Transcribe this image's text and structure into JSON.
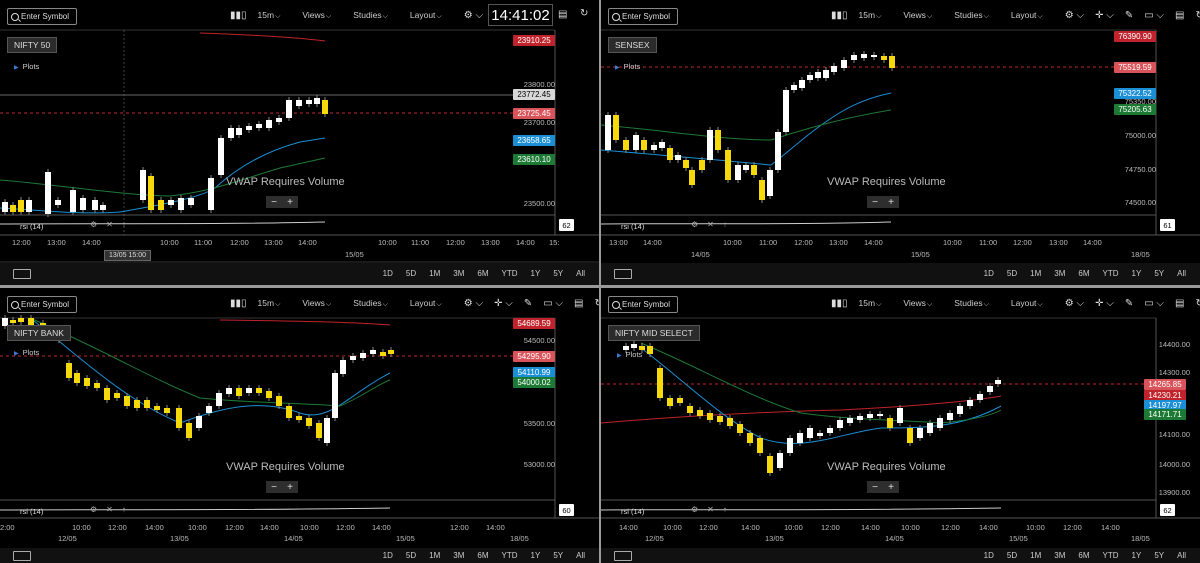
{
  "clock": "14:41:02",
  "toolbar": {
    "search_placeholder": "Enter Symbol",
    "interval": "15m",
    "views": "Views",
    "studies": "Studies",
    "layout": "Layout"
  },
  "panels": [
    {
      "symbol": "NIFTY 50",
      "plots": "Plots",
      "vwap_note": "VWAP Requires Volume",
      "zoom_minus": "−",
      "zoom_plus": "+",
      "rsi_label": "rsi (14)",
      "rsi_value": "62",
      "price_boxes": [
        {
          "text": "23910.25",
          "color": "#c0232b"
        },
        {
          "text": "23772.45",
          "color": "#d8d8d8"
        },
        {
          "text": "23725.45",
          "color": "#d9535a"
        },
        {
          "text": "23658.65",
          "color": "#1a8fd6"
        },
        {
          "text": "23610.10",
          "color": "#1d7a35"
        }
      ],
      "axis_labels": [
        "23800.00",
        "23700.00",
        "23500.00"
      ],
      "time_labels": [
        "12:00",
        "13:00",
        "14:00",
        "10:00",
        "11:00",
        "12:00",
        "13:00",
        "14:00",
        "10:00",
        "11:00",
        "12:00",
        "13:00",
        "14:00",
        "15:"
      ],
      "date_labels": [
        "15/05"
      ],
      "tooltip": "13/05 15:00"
    },
    {
      "symbol": "SENSEX",
      "plots": "Plots",
      "vwap_note": "VWAP Requires Volume",
      "zoom_minus": "−",
      "zoom_plus": "+",
      "rsi_label": "rsi (14)",
      "rsi_value": "61",
      "price_boxes": [
        {
          "text": "76390.90",
          "color": "#c0232b"
        },
        {
          "text": "75519.59",
          "color": "#d9535a"
        },
        {
          "text": "75322.52",
          "color": "#1a8fd6"
        },
        {
          "text": "75205.63",
          "color": "#1d7a35"
        }
      ],
      "axis_labels": [
        "75350.00",
        "75000.00",
        "74750.00",
        "74500.00"
      ],
      "time_labels": [
        "13:00",
        "14:00",
        "10:00",
        "11:00",
        "12:00",
        "13:00",
        "14:00",
        "10:00",
        "11:00",
        "12:00",
        "13:00",
        "14:00"
      ],
      "date_labels": [
        "14/05",
        "15/05",
        "18/05"
      ]
    },
    {
      "symbol": "NIFTY BANK",
      "plots": "Plots",
      "vwap_note": "VWAP Requires Volume",
      "zoom_minus": "−",
      "zoom_plus": "+",
      "rsi_label": "rsi (14)",
      "rsi_value": "60",
      "price_boxes": [
        {
          "text": "54689.59",
          "color": "#c0232b"
        },
        {
          "text": "54295.90",
          "color": "#d9535a"
        },
        {
          "text": "54110.99",
          "color": "#1a8fd6"
        },
        {
          "text": "54000.02",
          "color": "#1d7a35"
        }
      ],
      "axis_labels": [
        "54500.00",
        "53500.00",
        "53000.00"
      ],
      "time_labels": [
        "2:00",
        "10:00",
        "12:00",
        "14:00",
        "10:00",
        "12:00",
        "14:00",
        "10:00",
        "12:00",
        "14:00",
        "12:00",
        "14:00"
      ],
      "date_labels": [
        "12/05",
        "13/05",
        "14/05",
        "15/05",
        "18/05"
      ]
    },
    {
      "symbol": "NIFTY MID SELECT",
      "plots": "Plots",
      "vwap_note": "VWAP Requires Volume",
      "zoom_minus": "−",
      "zoom_plus": "+",
      "rsi_label": "rsi (14)",
      "rsi_value": "62",
      "price_boxes": [
        {
          "text": "14265.85",
          "color": "#d9535a"
        },
        {
          "text": "14230.21",
          "color": "#c0232b"
        },
        {
          "text": "14197.97",
          "color": "#1a8fd6"
        },
        {
          "text": "14171.71",
          "color": "#1d7a35"
        }
      ],
      "axis_labels": [
        "14400.00",
        "14300.00",
        "14100.00",
        "14000.00",
        "13900.00"
      ],
      "time_labels": [
        "14:00",
        "10:00",
        "12:00",
        "14:00",
        "10:00",
        "12:00",
        "14:00",
        "10:00",
        "12:00",
        "14:00",
        "10:00",
        "12:00",
        "14:00"
      ],
      "date_labels": [
        "12/05",
        "13/05",
        "14/05",
        "15/05",
        "18/05"
      ]
    }
  ],
  "ranges": [
    "1D",
    "5D",
    "1M",
    "3M",
    "6M",
    "YTD",
    "1Y",
    "5Y",
    "All"
  ],
  "colors": {
    "up_candle": "#ffffff",
    "down_candle": "#f5d90a",
    "ema_blue": "#1a8fd6",
    "ema_green": "#1d7a35",
    "ema_red": "#c0232b",
    "prev_close_dash": "#d9535a"
  }
}
